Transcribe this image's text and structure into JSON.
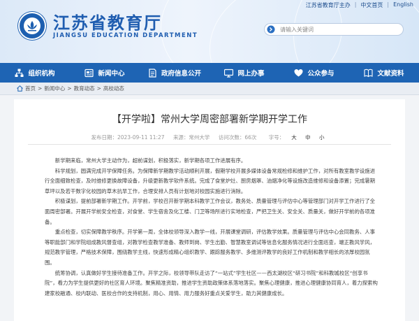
{
  "header": {
    "links": [
      "江苏省教育厅主办",
      "中文首页",
      "English"
    ],
    "title": "江苏省教育厅",
    "subtitle": "JIANGSU EDUCATION DEPARTMENT",
    "search_placeholder": "请输入关键词"
  },
  "nav": {
    "items": [
      {
        "label": "组织机构",
        "icon": "sitemap-icon"
      },
      {
        "label": "新闻中心",
        "icon": "news-icon"
      },
      {
        "label": "政府信息公开",
        "icon": "government-info-icon"
      },
      {
        "label": "网上办事",
        "icon": "online-service-icon"
      },
      {
        "label": "公众参与",
        "icon": "public-participation-icon"
      },
      {
        "label": "文献资料",
        "icon": "documents-icon"
      }
    ]
  },
  "breadcrumb": [
    "首页",
    "新闻中心",
    "教育动态",
    "高校动态"
  ],
  "article": {
    "title": "【开学啦】常州大学周密部署新学期开学工作",
    "published": "发布日期：2023-09-11 11:27",
    "source": "来源：常州大学",
    "views": "访问次数：66次",
    "font_label": "字号：",
    "font_sizes": [
      "大",
      "中",
      "小"
    ],
    "paragraphs": [
      "新学期来临，常州大学主动作为，超前谋划，积极落实，新学期各项工作进展有序。",
      "科学规划，圆满完成开学保障任务。为保障新学期教学活动顺利开展，假期学校开展多媒体设备常规检修和维护工作，对所有教室教学设施进行全面细致检查，及时维修更换故障设备，升级更新教学软件系统。完成了食堂炉灶、厨房烟罩、油烟净化等设施改造维修和设备添置；完成暑期草坪以及若干数字化校园的草木抗旱工作，合理安排人员有计划地对校园实施进行消除。",
      "积极谋划，提前部署新学期工作。开学前，学校召开新学期本科教学工作会议，教务处、质量管理与评估中心等管理部门对开学工作进行了全面周密部署。开展开学前安全检查，对食堂、学生宿舍及化工楼、门卫等场所进行实地检查，严把卫生关、安全关、质量关，做好开学前的各项准备。",
      "重点检查，切实保障教学秩序。开学第一周，全体校领导深入教学一线，开展课堂调研，评估教学效果。质量管理与评估中心会同教务、人事等职能部门和学院组成教风督查组，对教学检查教学准备、教师到岗、学生出勤、智慧教室调试等信息化服务情况进行全面巡查，端正教风学风，规范教学管理，严格技术保障，围绕教学主线，快速形成精心组织教学、跟踪服务教学、多维测评教学的良好工作机制和教学相长的浓厚校园氛围。",
      "统筹协调，认真做好学生接待准备工作。开学之际，校领导带队走访了“一站式”学生社区——西太湖校区“研习书院”和科教城校区“创享书院”，看力为学生提供更好的社区育人环境。聚焦精准资助，推进学生资助政策体系落地落实。聚焦心理健康，推进心理健康协同育人，着力探索构建家校融通、校内联动、医校合作的支持机制，用心、用情、用力服务好重点关爱学生，助力其健康成长。"
    ]
  },
  "colors": {
    "brand": "#1e64b4",
    "title_text": "#1f5db0"
  }
}
